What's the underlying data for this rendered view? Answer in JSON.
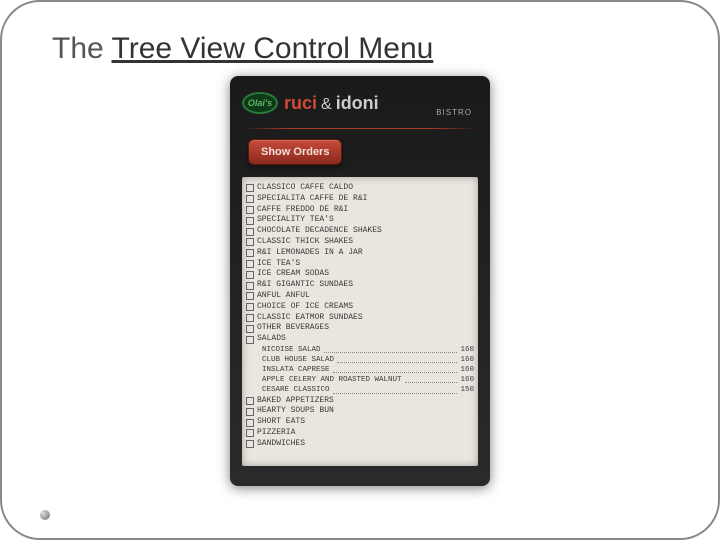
{
  "title_prefix": "The ",
  "title_main": "Tree View Control Menu",
  "brand": {
    "oval": "Olai's",
    "main": "ruci",
    "amp": "&",
    "sub": "idoni",
    "tag": "BISTRO"
  },
  "button_label": "Show Orders",
  "categories": [
    "CLASSICO CAFFE CALDO",
    "SPECIALITA CAFFE DE R&I",
    "CAFFE FREDDO DE R&I",
    "SPECIALITY TEA'S",
    "CHOCOLATE DECADENCE SHAKES",
    "CLASSIC THICK SHAKES",
    "R&I LEMONADES IN A JAR",
    "ICE TEA'S",
    "ICE CREAM SODAS",
    "R&I GIGANTIC SUNDAES",
    "ANFUL ANFUL",
    "CHOICE OF ICE CREAMS",
    "CLASSIC EATMOR SUNDAES",
    "OTHER BEVERAGES"
  ],
  "expanded": {
    "label": "SALADS",
    "items": [
      {
        "name": "NICOISE SALAD",
        "price": "160"
      },
      {
        "name": "CLUB HOUSE SALAD",
        "price": "160"
      },
      {
        "name": "INSLATA CAPRESE",
        "price": "160"
      },
      {
        "name": "APPLE CELERY AND ROASTED WALNUT",
        "price": "160"
      },
      {
        "name": "CESARE CLASSICO",
        "price": "150"
      }
    ]
  },
  "categories_after": [
    "BAKED APPETIZERS",
    "HEARTY SOUPS BUN",
    "SHORT EATS",
    "PIZZERIA",
    "SANDWICHES"
  ]
}
